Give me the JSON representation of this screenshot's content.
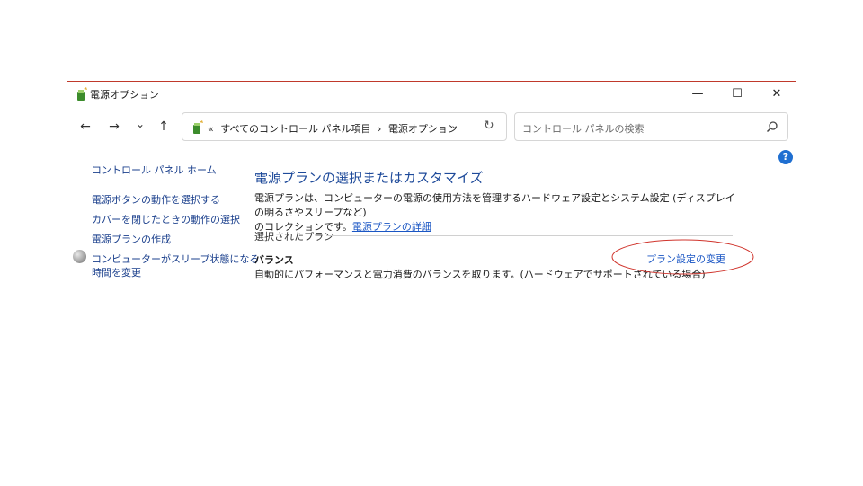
{
  "window": {
    "title": "電源オプション",
    "controls": {
      "minimize": "—",
      "maximize": "☐",
      "close": "✕"
    }
  },
  "toolbar": {
    "back": "←",
    "forward": "→",
    "recent": "⌄",
    "up": "↑",
    "address": {
      "prefix": "«",
      "crumbs": [
        "すべてのコントロール パネル項目",
        "›",
        "電源オプション"
      ],
      "dropdown": "⌄",
      "refresh": "↻"
    },
    "search": {
      "placeholder": "コントロール パネルの検索"
    }
  },
  "help": {
    "label": "?"
  },
  "sidebar": {
    "items": [
      {
        "label": "コントロール パネル ホーム"
      },
      {
        "label": "電源ボタンの動作を選択する"
      },
      {
        "label": "カバーを閉じたときの動作の選択"
      },
      {
        "label": "電源プランの作成"
      },
      {
        "label_line1": "コンピューターがスリープ状態になる",
        "label_line2": "時間を変更"
      }
    ]
  },
  "main": {
    "heading": "電源プランの選択またはカスタマイズ",
    "description_line1": "電源プランは、コンピューターの電源の使用方法を管理するハードウェア設定とシステム設定 (ディスプレイの明るさやスリープなど)",
    "description_line2": "のコレクションです。",
    "description_link": "電源プランの詳細",
    "selected_label": "選択されたプラン",
    "plan": {
      "name": "バランス",
      "description": "自動的にパフォーマンスと電力消費のバランスを取ります。(ハードウェアでサポートされている場合)",
      "change_link": "プラン設定の変更"
    }
  },
  "annotation": {
    "ellipse_color": "#d0342c"
  }
}
